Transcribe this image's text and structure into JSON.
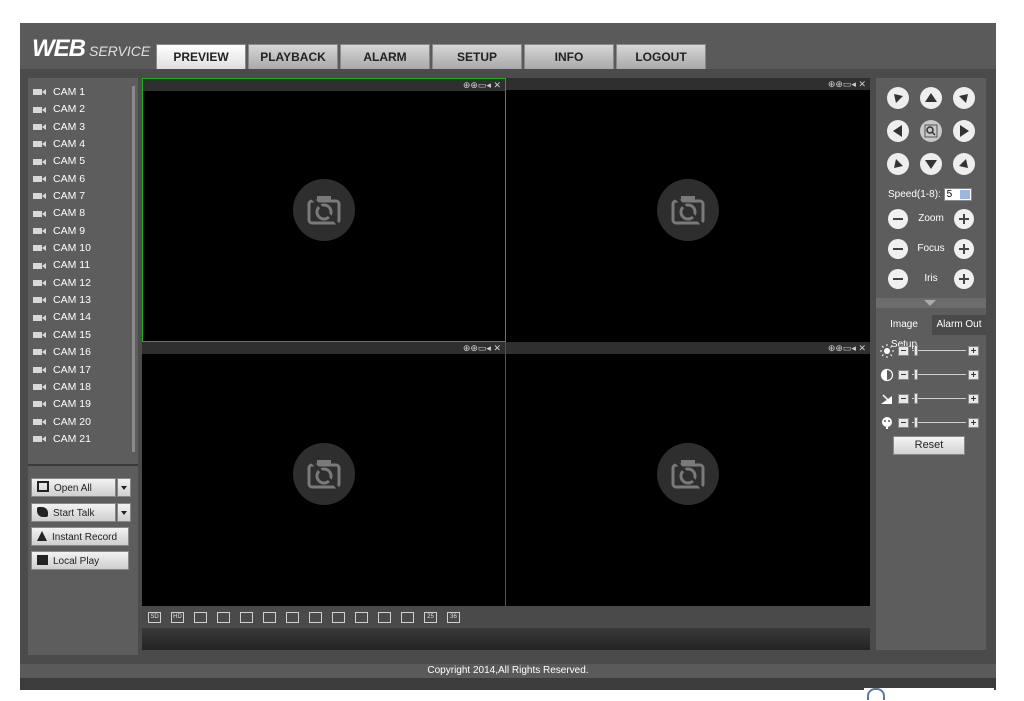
{
  "brand": {
    "title": "WEB",
    "subtitle": "SERVICE"
  },
  "tabs": [
    {
      "label": "PREVIEW",
      "active": true
    },
    {
      "label": "PLAYBACK",
      "active": false
    },
    {
      "label": "ALARM",
      "active": false
    },
    {
      "label": "SETUP",
      "active": false
    },
    {
      "label": "INFO",
      "active": false
    },
    {
      "label": "LOGOUT",
      "active": false
    }
  ],
  "cameras": [
    "CAM 1",
    "CAM 2",
    "CAM 3",
    "CAM 4",
    "CAM 5",
    "CAM 6",
    "CAM 7",
    "CAM 8",
    "CAM 9",
    "CAM 10",
    "CAM 11",
    "CAM 12",
    "CAM 13",
    "CAM 14",
    "CAM 15",
    "CAM 16",
    "CAM 17",
    "CAM 18",
    "CAM 19",
    "CAM 20",
    "CAM 21"
  ],
  "left_buttons": {
    "open_all": "Open All",
    "start_talk": "Start Talk",
    "instant_record": "Instant Record",
    "local_play": "Local Play"
  },
  "ptz": {
    "speed_label": "Speed(1-8):",
    "speed_value": "5",
    "zoom_label": "Zoom",
    "focus_label": "Focus",
    "iris_label": "Iris"
  },
  "image_tabs": {
    "setup": "Image Setup",
    "alarm_out": "Alarm Out"
  },
  "image_sliders": [
    {
      "name": "brightness",
      "icon": "brightness-icon"
    },
    {
      "name": "contrast",
      "icon": "contrast-icon"
    },
    {
      "name": "saturation",
      "icon": "saturation-icon"
    },
    {
      "name": "hue",
      "icon": "hue-icon"
    }
  ],
  "reset_label": "Reset",
  "pane_tool_icons": "⊕⊕▭◂ ✕",
  "view_modes": [
    "SD",
    "HD",
    "fullscreen",
    "split-1-wide",
    "split-1",
    "split-4",
    "split-6",
    "split-8",
    "split-9",
    "split-13",
    "split-16",
    "split-20",
    "split-25",
    "split-36"
  ],
  "view_mode_labels": {
    "sd": "SD",
    "hd": "HD",
    "25": "25",
    "36": "36"
  },
  "footer": {
    "copyright": "Copyright 2014,All Rights Reserved."
  },
  "colors": {
    "active_pane_border": "#19b019",
    "background": "#4b4b4b"
  }
}
